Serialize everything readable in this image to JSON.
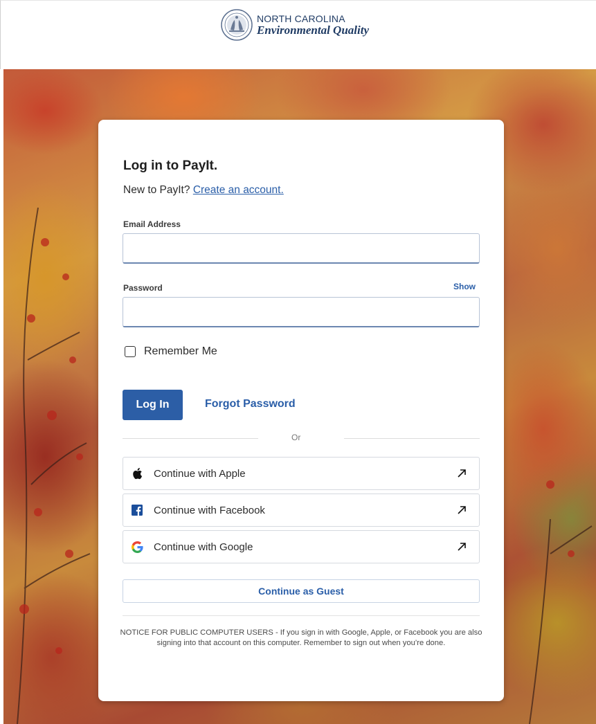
{
  "brand": {
    "line1": "NORTH CAROLINA",
    "line2": "Environmental Quality",
    "seal_icon": "nc-state-seal-icon",
    "color": "#1f3b64"
  },
  "login": {
    "title": "Log in to PayIt.",
    "new_prompt": "New to PayIt?",
    "create_link": "Create an account.",
    "email_label": "Email Address",
    "email_value": "",
    "password_label": "Password",
    "password_value": "",
    "show_label": "Show",
    "remember_label": "Remember Me",
    "remember_checked": false,
    "login_button": "Log In",
    "forgot_link": "Forgot Password",
    "or_text": "Or",
    "accent": "#2c5ea6"
  },
  "social": [
    {
      "label": "Continue with Apple",
      "icon": "apple-icon"
    },
    {
      "label": "Continue with Facebook",
      "icon": "facebook-icon"
    },
    {
      "label": "Continue with Google",
      "icon": "google-icon"
    }
  ],
  "guest_button": "Continue as Guest",
  "notice": "NOTICE FOR PUBLIC COMPUTER USERS - If you sign in with Google, Apple, or Facebook you are also signing into that account on this computer. Remember to sign out when you’re done."
}
